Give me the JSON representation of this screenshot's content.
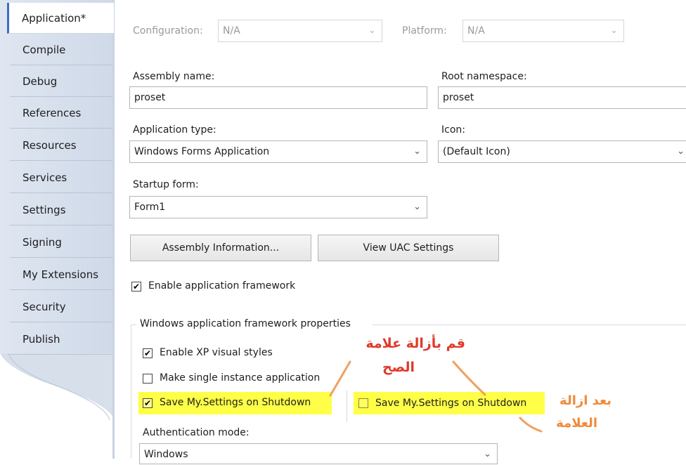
{
  "sidebar": {
    "tabs": [
      {
        "label": "Application*",
        "active": true
      },
      {
        "label": "Compile"
      },
      {
        "label": "Debug"
      },
      {
        "label": "References"
      },
      {
        "label": "Resources"
      },
      {
        "label": "Services"
      },
      {
        "label": "Settings"
      },
      {
        "label": "Signing"
      },
      {
        "label": "My Extensions"
      },
      {
        "label": "Security"
      },
      {
        "label": "Publish"
      }
    ]
  },
  "config": {
    "configuration_label": "Configuration:",
    "configuration_value": "N/A",
    "platform_label": "Platform:",
    "platform_value": "N/A"
  },
  "assembly": {
    "name_label": "Assembly name:",
    "name_value": "proset",
    "root_ns_label": "Root namespace:",
    "root_ns_value": "proset"
  },
  "app_type": {
    "label": "Application type:",
    "value": "Windows Forms Application",
    "icon_label": "Icon:",
    "icon_value": "(Default Icon)"
  },
  "startup": {
    "label": "Startup form:",
    "value": "Form1"
  },
  "buttons": {
    "assembly_info": "Assembly Information...",
    "uac": "View UAC Settings"
  },
  "framework": {
    "enable_label": "Enable application framework",
    "enable_checked": true,
    "group_title": "Windows application framework properties",
    "xp_styles_label": "Enable XP visual styles",
    "xp_styles_checked": true,
    "single_instance_label": "Make single instance application",
    "single_instance_checked": false,
    "save_settings_label": "Save My.Settings on Shutdown",
    "save_settings_checked": true,
    "save_settings_after_label": "Save My.Settings on Shutdown",
    "save_settings_after_checked": false,
    "auth_label": "Authentication mode:",
    "auth_value": "Windows"
  },
  "annotations": {
    "remove_check": "قم بأزالة علامة",
    "remove_check_2": "الصح",
    "after_remove": "بعد ازالة",
    "after_remove_2": "العلامة"
  },
  "icons": {
    "dropdown": "chevron-down-icon",
    "check": "checkmark-icon"
  },
  "colors": {
    "highlight": "#ffff47",
    "arabic_red": "#e03a2a",
    "arabic_orange": "#f08a3a",
    "active_tab_accent": "#3c6ec0"
  }
}
